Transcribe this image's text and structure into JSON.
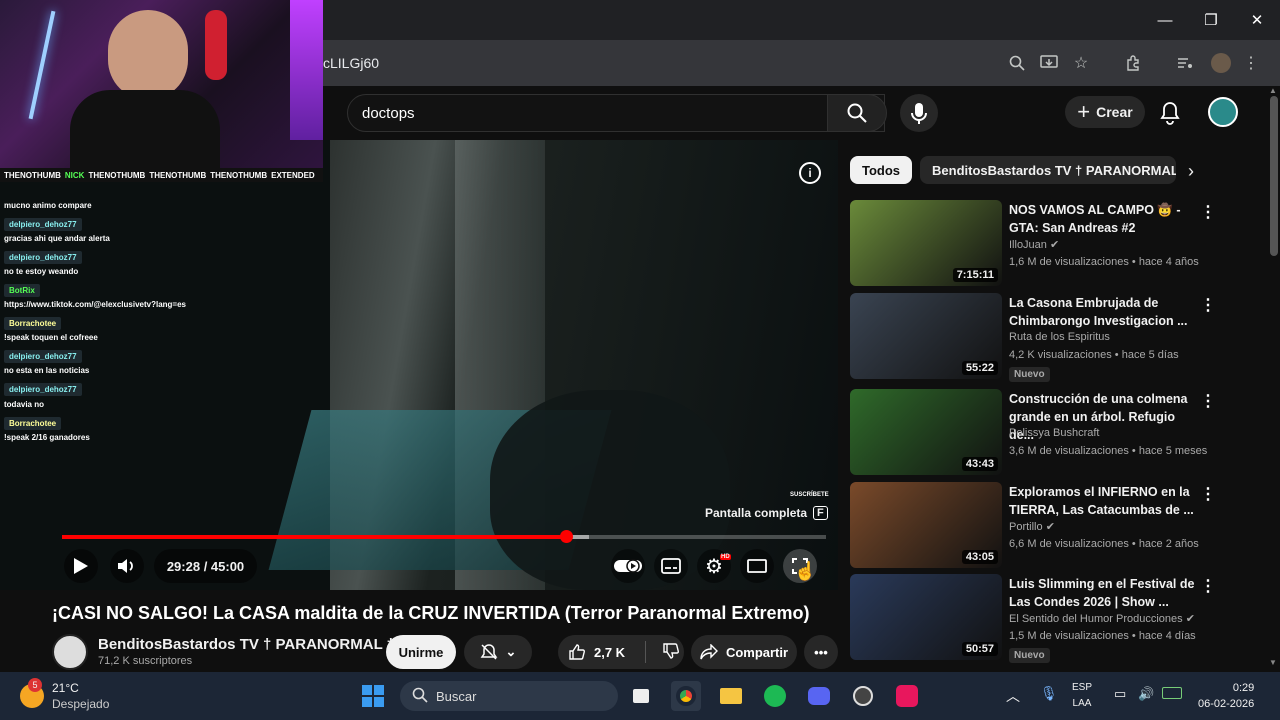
{
  "browser": {
    "url": "cLILGj60",
    "window_controls": {
      "minimize": "—",
      "maximize": "❐",
      "close": "✕"
    }
  },
  "youtube_header": {
    "search_value": "doctops",
    "create_label": "Crear"
  },
  "player": {
    "time": "29:28 / 45:00",
    "progress_fraction": 0.66,
    "tooltip": "Pantalla completa",
    "tooltip_key": "F",
    "subscribe_watermark": "SUSCRÍBETE"
  },
  "stream_overlay": {
    "socials": [
      "THENOTHUMB",
      "NICK",
      "THENOTHUMB",
      "THENOTHUMB",
      "THENOTHUMB",
      "EXTENDED"
    ],
    "chat": [
      {
        "type": "msg",
        "text": "mucno animo compare"
      },
      {
        "type": "name",
        "text": "delpiero_dehoz77"
      },
      {
        "type": "msg",
        "text": "gracias ahi que andar alerta"
      },
      {
        "type": "name",
        "text": "delpiero_dehoz77"
      },
      {
        "type": "msg",
        "text": "no te estoy weando"
      },
      {
        "type": "name",
        "text": "BotRix"
      },
      {
        "type": "msg",
        "text": "https://www.tiktok.com/@elexclusivetv?lang=es"
      },
      {
        "type": "name",
        "text": "Borrachotee"
      },
      {
        "type": "msg",
        "text": "!speak toquen el cofreee"
      },
      {
        "type": "name",
        "text": "delpiero_dehoz77"
      },
      {
        "type": "msg",
        "text": "no esta en las noticias"
      },
      {
        "type": "name",
        "text": "delpiero_dehoz77"
      },
      {
        "type": "msg",
        "text": "todavia no"
      },
      {
        "type": "name",
        "text": "Borrachotee"
      },
      {
        "type": "msg",
        "text": "!speak 2/16 ganadores"
      }
    ]
  },
  "video": {
    "title": "¡CASI NO SALGO! La CASA maldita de la CRUZ INVERTIDA (Terror Paranormal Extremo)",
    "channel": "BenditosBastardos TV † PARANORMAL †",
    "subscribers": "71,2 K suscriptores",
    "join_label": "Unirme",
    "likes": "2,7 K",
    "share_label": "Compartir"
  },
  "sidebar": {
    "chips": [
      "Todos",
      "BenditosBastardos TV † PARANORMAL †"
    ],
    "recommendations": [
      {
        "title": "NOS VAMOS AL CAMPO 🤠 - GTA: San Andreas #2",
        "channel": "IlloJuan",
        "verified": true,
        "views": "1,6 M de visualizaciones",
        "age": "hace 4 años",
        "duration": "7:15:11",
        "badge": "",
        "thumb_color": "#6a8a3a"
      },
      {
        "title": "La Casona Embrujada de Chimbarongo Investigacion ...",
        "channel": "Ruta de los Espiritus",
        "verified": false,
        "views": "4,2 K visualizaciones",
        "age": "hace 5 días",
        "duration": "55:22",
        "badge": "Nuevo",
        "thumb_color": "#3a4452"
      },
      {
        "title": "Construcción de una colmena grande en un árbol. Refugio de...",
        "channel": "Polissya Bushcraft",
        "verified": false,
        "views": "3,6 M de visualizaciones",
        "age": "hace 5 meses",
        "duration": "43:43",
        "badge": "",
        "thumb_color": "#2f6a2a"
      },
      {
        "title": "Exploramos el INFIERNO en la TIERRA, Las Catacumbas de ...",
        "channel": "Portillo",
        "verified": true,
        "views": "6,6 M de visualizaciones",
        "age": "hace 2 años",
        "duration": "43:05",
        "badge": "",
        "thumb_color": "#7a4a2a"
      },
      {
        "title": "Luis Slimming en el Festival de Las Condes 2026 | Show ...",
        "channel": "El Sentido del Humor Producciones",
        "verified": true,
        "views": "1,5 M de visualizaciones",
        "age": "hace 4 días",
        "duration": "50:57",
        "badge": "Nuevo",
        "thumb_color": "#2a3a5a"
      }
    ]
  },
  "taskbar": {
    "temperature": "21°C",
    "weather": "Despejado",
    "weather_badge": "5",
    "search_placeholder": "Buscar",
    "lang1": "ESP",
    "lang2": "LAA",
    "time": "0:29",
    "date": "06-02-2026"
  }
}
